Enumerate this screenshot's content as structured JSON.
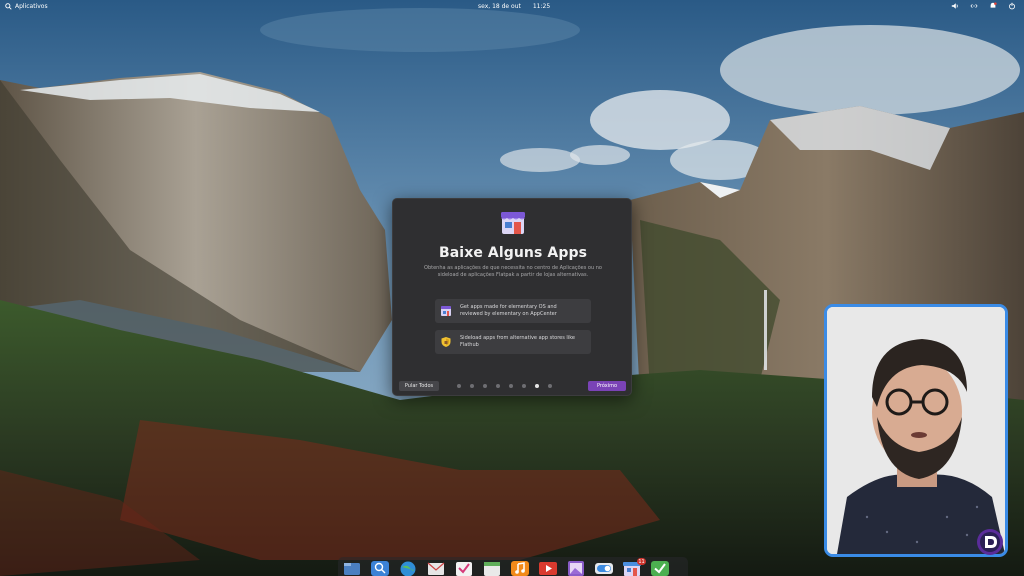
{
  "panel": {
    "apps_label": "Aplicativos",
    "date": "sex, 18 de out",
    "time": "11:25"
  },
  "dialog": {
    "title": "Baixe Alguns Apps",
    "subtitle": "Obtenha as aplicações de que necessita no centro de Aplicações ou no sideload de aplicações Flatpak a partir de lojas alternativas.",
    "features": [
      {
        "icon": "appcenter-icon",
        "text": "Get apps made for elementary OS and reviewed by elementary on AppCenter"
      },
      {
        "icon": "shield-icon",
        "text": "Sideload apps from alternative app stores like Flathub"
      }
    ],
    "skip_label": "Pular Todos",
    "next_label": "Próximo",
    "pages_total": 8,
    "active_page": 6
  },
  "dock": {
    "items": [
      {
        "icon": "files-icon",
        "color": "#4a7fc1"
      },
      {
        "icon": "search-app-icon",
        "color": "#3b82d6"
      },
      {
        "icon": "web-browser-icon",
        "color": "#2f8fd6"
      },
      {
        "icon": "mail-icon",
        "color": "#e6e6e6"
      },
      {
        "icon": "tasks-icon",
        "color": "#f2f2f2"
      },
      {
        "icon": "calendar-icon",
        "color": "#e9e9e9"
      },
      {
        "icon": "music-icon",
        "color": "#f28a1a"
      },
      {
        "icon": "videos-icon",
        "color": "#d93a2e"
      },
      {
        "icon": "photos-icon",
        "color": "#8a5cc9"
      },
      {
        "icon": "settings-toggle-icon",
        "color": "#3d8be0"
      },
      {
        "icon": "appcenter-icon",
        "color": "#4a8fe0",
        "badge": "11"
      },
      {
        "icon": "checkmark-icon",
        "color": "#4caf50"
      }
    ]
  },
  "colors": {
    "accent": "#7a43b6",
    "webcam_border": "#3a8be6"
  }
}
